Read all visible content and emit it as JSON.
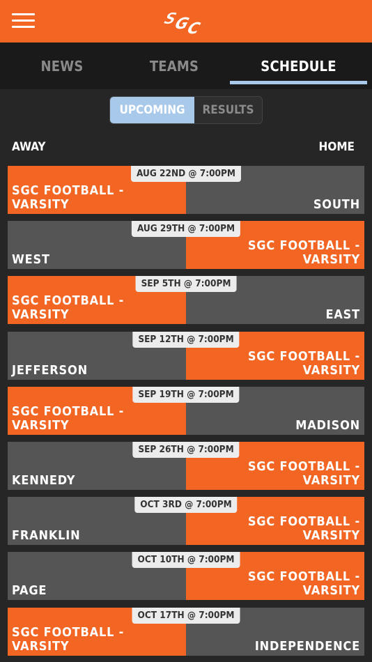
{
  "header": {
    "logo_text": "SGC"
  },
  "tabs": [
    {
      "label": "NEWS",
      "active": false
    },
    {
      "label": "TEAMS",
      "active": false
    },
    {
      "label": "SCHEDULE",
      "active": true
    }
  ],
  "segment": {
    "upcoming": "UPCOMING",
    "results": "RESULTS",
    "selected": "UPCOMING"
  },
  "columns": {
    "away": "AWAY",
    "home": "HOME"
  },
  "colors": {
    "accent": "#f26522",
    "away_bg": "#555555",
    "highlight": "#a9c9ea"
  },
  "games": [
    {
      "date": "AUG 22ND @ 7:00PM",
      "away": "SGC FOOTBALL -\nVARSITY",
      "home": "SOUTH",
      "sgc_side": "away"
    },
    {
      "date": "AUG 29TH @ 7:00PM",
      "away": "WEST",
      "home": "SGC FOOTBALL -\nVARSITY",
      "sgc_side": "home"
    },
    {
      "date": "SEP 5TH @ 7:00PM",
      "away": "SGC FOOTBALL -\nVARSITY",
      "home": "EAST",
      "sgc_side": "away"
    },
    {
      "date": "SEP 12TH @ 7:00PM",
      "away": "JEFFERSON",
      "home": "SGC FOOTBALL -\nVARSITY",
      "sgc_side": "home"
    },
    {
      "date": "SEP 19TH @ 7:00PM",
      "away": "SGC FOOTBALL -\nVARSITY",
      "home": "MADISON",
      "sgc_side": "away"
    },
    {
      "date": "SEP 26TH @ 7:00PM",
      "away": "KENNEDY",
      "home": "SGC FOOTBALL -\nVARSITY",
      "sgc_side": "home"
    },
    {
      "date": "OCT 3RD @ 7:00PM",
      "away": "FRANKLIN",
      "home": "SGC FOOTBALL -\nVARSITY",
      "sgc_side": "home"
    },
    {
      "date": "OCT 10TH @ 7:00PM",
      "away": "PAGE",
      "home": "SGC FOOTBALL -\nVARSITY",
      "sgc_side": "home"
    },
    {
      "date": "OCT 17TH @ 7:00PM",
      "away": "SGC FOOTBALL -\nVARSITY",
      "home": "INDEPENDENCE",
      "sgc_side": "away"
    }
  ]
}
